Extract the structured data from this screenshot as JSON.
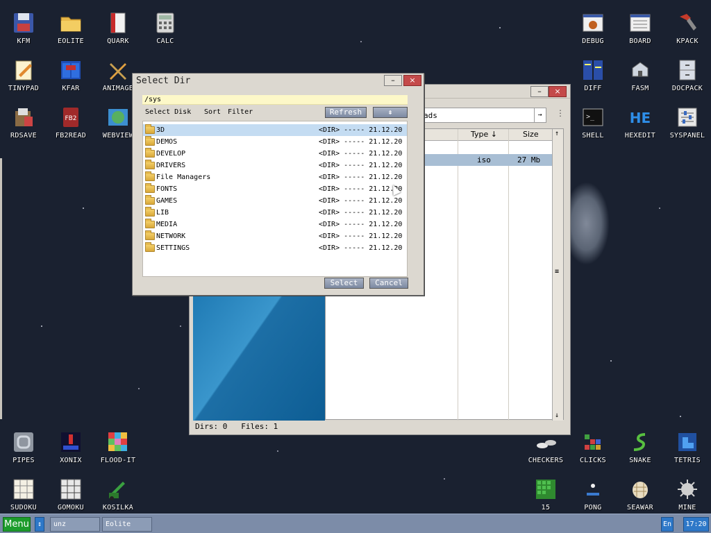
{
  "desktop_icons": [
    {
      "id": "kfm",
      "label": "KFM",
      "icon": "floppy-disk-icon",
      "x": 0,
      "y": 0
    },
    {
      "id": "eolite",
      "label": "EOLITE",
      "icon": "folder-icon"
    },
    {
      "id": "quark",
      "label": "QUARK",
      "icon": "book-icon"
    },
    {
      "id": "calc",
      "label": "CALC",
      "icon": "calculator-icon"
    },
    {
      "id": "tinypad",
      "label": "TINYPAD",
      "icon": "notepad-icon"
    },
    {
      "id": "kfar",
      "label": "KFAR",
      "icon": "dual-panel-icon"
    },
    {
      "id": "animage",
      "label": "ANIMAGE",
      "icon": "pencil-brush-icon"
    },
    {
      "id": "rdsave",
      "label": "RDSAVE",
      "icon": "save-disk-icon"
    },
    {
      "id": "fb2read",
      "label": "FB2READ",
      "icon": "ebook-icon"
    },
    {
      "id": "webview",
      "label": "WEBVIEW",
      "icon": "globe-icon"
    },
    {
      "id": "debug",
      "label": "DEBUG",
      "icon": "bug-icon"
    },
    {
      "id": "board",
      "label": "BOARD",
      "icon": "board-icon"
    },
    {
      "id": "kpack",
      "label": "KPACK",
      "icon": "hammer-icon"
    },
    {
      "id": "diff",
      "label": "DIFF",
      "icon": "compare-icon"
    },
    {
      "id": "fasm",
      "label": "FASM",
      "icon": "assembler-icon"
    },
    {
      "id": "docpack",
      "label": "DOCPACK",
      "icon": "cabinet-icon"
    },
    {
      "id": "shell",
      "label": "SHELL",
      "icon": "terminal-icon"
    },
    {
      "id": "hexedit",
      "label": "HEXEDIT",
      "icon": "hex-icon"
    },
    {
      "id": "syspanel",
      "label": "SYSPANEL",
      "icon": "sliders-icon"
    },
    {
      "id": "pipes",
      "label": "PIPES",
      "icon": "pipe-icon"
    },
    {
      "id": "xonix",
      "label": "XONIX",
      "icon": "xonix-icon"
    },
    {
      "id": "floodit",
      "label": "FLOOD-IT",
      "icon": "color-grid-icon"
    },
    {
      "id": "sudoku",
      "label": "SUDOKU",
      "icon": "sudoku-icon"
    },
    {
      "id": "gomoku",
      "label": "GOMOKU",
      "icon": "tictactoe-icon"
    },
    {
      "id": "kosilka",
      "label": "KOSILKA",
      "icon": "lawnmower-icon"
    },
    {
      "id": "checkers",
      "label": "CHECKERS",
      "icon": "checkers-icon"
    },
    {
      "id": "clicks",
      "label": "CLICKS",
      "icon": "blocks-icon"
    },
    {
      "id": "snake",
      "label": "SNAKE",
      "icon": "snake-icon"
    },
    {
      "id": "tetris",
      "label": "TETRIS",
      "icon": "tetris-icon"
    },
    {
      "id": "fifteen",
      "label": "15",
      "icon": "fifteen-puzzle-icon"
    },
    {
      "id": "pong",
      "label": "PONG",
      "icon": "pong-icon"
    },
    {
      "id": "seawar",
      "label": "SEAWAR",
      "icon": "seawar-icon"
    },
    {
      "id": "mine",
      "label": "MINE",
      "icon": "mine-icon"
    }
  ],
  "bg_window": {
    "address": "ads",
    "address_btn": "→",
    "more": "⋮",
    "columns": {
      "type": "Type ↓",
      "size": "Size",
      "up": "↑"
    },
    "row": {
      "type": "iso",
      "size": "27 Mb"
    },
    "status": "Dirs: 0   Files: 1",
    "min_label": "–",
    "close_label": "×",
    "scroll_up": "↑",
    "scroll_down": "↓",
    "scroll_grip": "≡"
  },
  "dialog": {
    "title": "Select Dir",
    "min_label": "–",
    "close_label": "×",
    "path": "/sys",
    "menu": {
      "disk": "Select Disk",
      "sort": "Sort",
      "filter": "Filter"
    },
    "refresh_label": "Refresh",
    "up_label": "⇞",
    "select_label": "Select",
    "cancel_label": "Cancel",
    "entries": [
      {
        "name": "3D",
        "type": "<DIR>",
        "attr": "-----",
        "date": "21.12.20",
        "selected": true
      },
      {
        "name": "DEMOS",
        "type": "<DIR>",
        "attr": "-----",
        "date": "21.12.20"
      },
      {
        "name": "DEVELOP",
        "type": "<DIR>",
        "attr": "-----",
        "date": "21.12.20"
      },
      {
        "name": "DRIVERS",
        "type": "<DIR>",
        "attr": "-----",
        "date": "21.12.20"
      },
      {
        "name": "File Managers",
        "type": "<DIR>",
        "attr": "-----",
        "date": "21.12.20"
      },
      {
        "name": "FONTS",
        "type": "<DIR>",
        "attr": "-----",
        "date": "21.12.20"
      },
      {
        "name": "GAMES",
        "type": "<DIR>",
        "attr": "-----",
        "date": "21.12.20"
      },
      {
        "name": "LIB",
        "type": "<DIR>",
        "attr": "-----",
        "date": "21.12.20"
      },
      {
        "name": "MEDIA",
        "type": "<DIR>",
        "attr": "-----",
        "date": "21.12.20"
      },
      {
        "name": "NETWORK",
        "type": "<DIR>",
        "attr": "-----",
        "date": "21.12.20"
      },
      {
        "name": "SETTINGS",
        "type": "<DIR>",
        "attr": "-----",
        "date": "21.12.20"
      }
    ]
  },
  "taskbar": {
    "menu_label": "Menu",
    "arrow_label": "↕",
    "tasks": [
      "unz",
      "Eolite"
    ],
    "lang": "En",
    "clock": "17:20"
  },
  "colors": {
    "menu_green": "#1c9c2c",
    "accent_blue": "#2e78c8",
    "selection": "#c4dcf2"
  }
}
